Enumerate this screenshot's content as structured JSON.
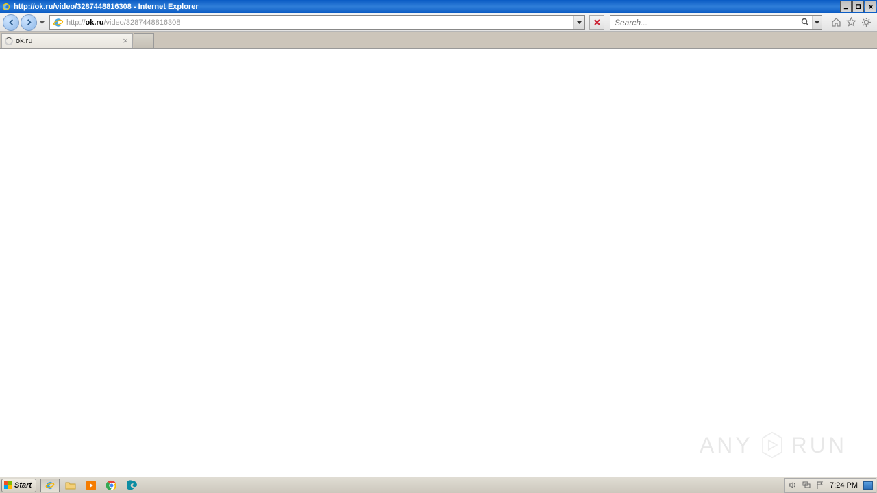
{
  "title": "http://ok.ru/video/3287448816308 - Internet Explorer",
  "url": {
    "protocol": "http://",
    "domain": "ok.ru",
    "path": "/video/3287448816308"
  },
  "search_placeholder": "Search...",
  "tab": {
    "title": "ok.ru"
  },
  "taskbar": {
    "start_label": "Start",
    "time": "7:24 PM"
  },
  "watermark": {
    "left": "ANY",
    "right": "RUN"
  }
}
